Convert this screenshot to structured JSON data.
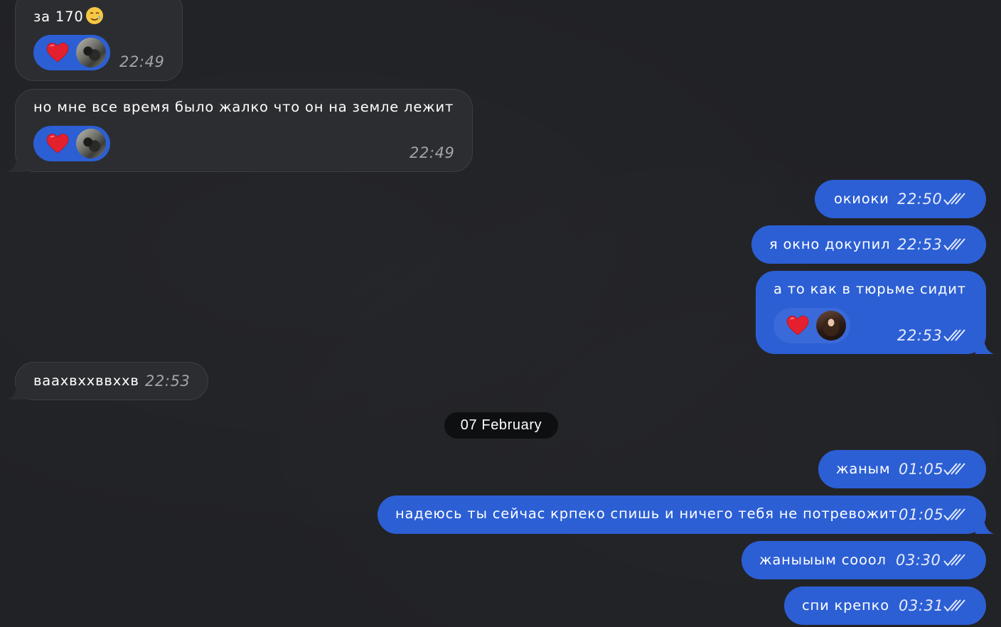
{
  "conversation": {
    "date_separator": "07 February",
    "colors": {
      "background": "#212226",
      "incoming_bubble": "#2c2d31",
      "outgoing_bubble": "#2c5fd4",
      "reaction_heart": "#e5202e"
    },
    "messages": [
      {
        "direction": "incoming",
        "text": "за 170",
        "emoji": "crying-smile",
        "time": "22:49",
        "reaction": "heart"
      },
      {
        "direction": "incoming",
        "text": "но мне все время было жалко что он на земле лежит",
        "time": "22:49",
        "reaction": "heart"
      },
      {
        "direction": "outgoing",
        "text": "окиоки",
        "time": "22:50",
        "status": "read"
      },
      {
        "direction": "outgoing",
        "text": "я окно докупил",
        "time": "22:53",
        "status": "read"
      },
      {
        "direction": "outgoing",
        "text": "а то как в тюрьме сидит",
        "time": "22:53",
        "status": "read",
        "reaction": "heart"
      },
      {
        "direction": "incoming",
        "text": "ваахвххввххв",
        "time": "22:53"
      },
      {
        "direction": "outgoing",
        "text": "жаным",
        "time": "01:05",
        "status": "read"
      },
      {
        "direction": "outgoing",
        "text": "надеюсь ты сейчас крпеко спишь и ничего тебя не потревожит",
        "time": "01:05",
        "status": "read"
      },
      {
        "direction": "outgoing",
        "text": "жаныыым сооол",
        "time": "03:30",
        "status": "read"
      },
      {
        "direction": "outgoing",
        "text": "спи крепко",
        "time": "03:31",
        "status": "read"
      }
    ]
  }
}
